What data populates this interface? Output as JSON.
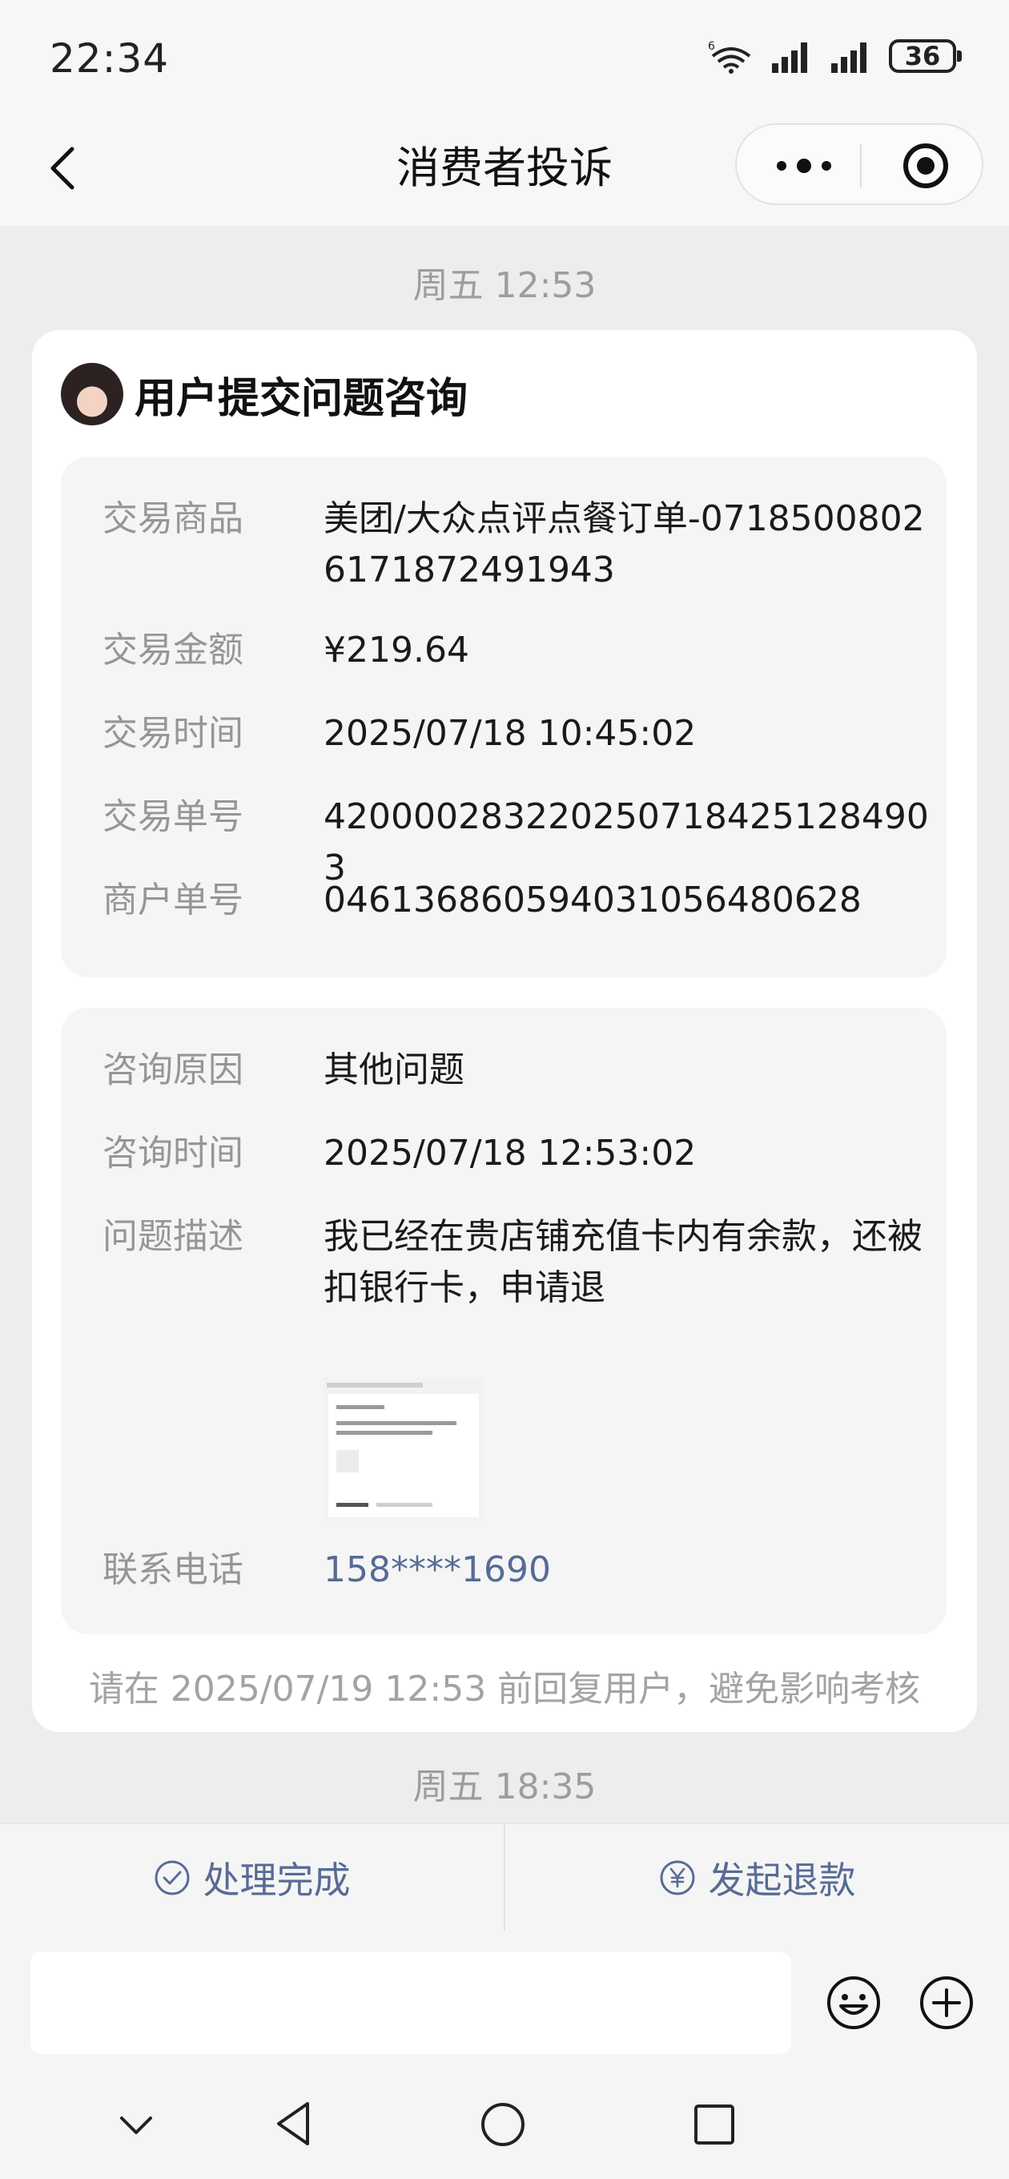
{
  "status_bar": {
    "time": "22:34",
    "battery": "36"
  },
  "nav": {
    "title": "消费者投诉"
  },
  "chat": {
    "timestamp_1": "周五 12:53",
    "timestamp_2": "周五 18:35",
    "card": {
      "title": "用户提交问题咨询",
      "transaction": {
        "product_label": "交易商品",
        "product_value": "美团/大众点评点餐订单-07185008026171872491943",
        "amount_label": "交易金额",
        "amount_value": "¥219.64",
        "time_label": "交易时间",
        "time_value": "2025/07/18 10:45:02",
        "order_no_label": "交易单号",
        "order_no_value": "4200002832202507184251284903",
        "merchant_no_label": "商户单号",
        "merchant_no_value": "046136860594031056480628"
      },
      "inquiry": {
        "reason_label": "咨询原因",
        "reason_value": "其他问题",
        "time_label": "咨询时间",
        "time_value": "2025/07/18 12:53:02",
        "desc_label": "问题描述",
        "desc_value": "我已经在贵店铺充值卡内有余款，还被扣银行卡，申请退",
        "phone_label": "联系电话",
        "phone_value": "158****1690"
      },
      "deadline_note": "请在 2025/07/19 12:53 前回复用户，避免影响考核"
    }
  },
  "actions": {
    "complete_label": "处理完成",
    "refund_label": "发起退款"
  },
  "input": {
    "placeholder": ""
  },
  "colors": {
    "link": "#576b95",
    "background": "#ededed",
    "card": "#ffffff",
    "panel": "#f5f5f5"
  },
  "icons": [
    "back-arrow-icon",
    "more-dots-icon",
    "target-icon",
    "check-circle-icon",
    "yuan-circle-icon",
    "emoji-icon",
    "plus-circle-icon"
  ]
}
